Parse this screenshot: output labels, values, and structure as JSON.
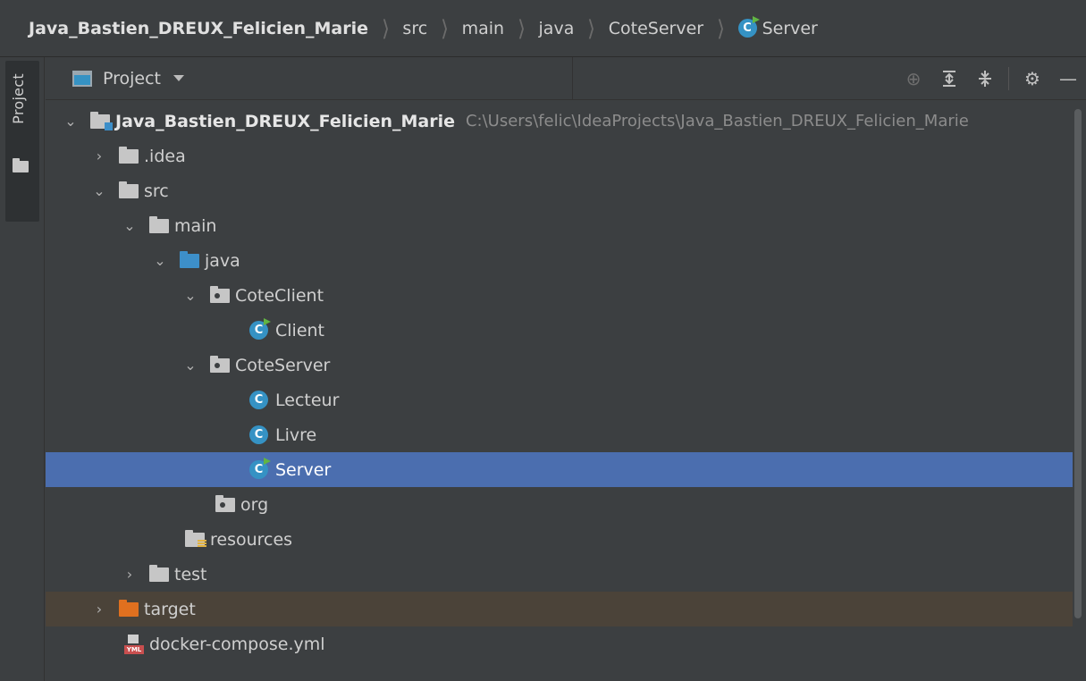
{
  "breadcrumb": {
    "items": [
      "Java_Bastien_DREUX_Felicien_Marie",
      "src",
      "main",
      "java",
      "CoteServer",
      "Server"
    ]
  },
  "tool_window": {
    "tab_label": "Project"
  },
  "project_panel": {
    "title": "Project"
  },
  "tree": {
    "root_name": "Java_Bastien_DREUX_Felicien_Marie",
    "root_path": "C:\\Users\\felic\\IdeaProjects\\Java_Bastien_DREUX_Felicien_Marie",
    "idea": ".idea",
    "src": "src",
    "main": "main",
    "java": "java",
    "cote_client": "CoteClient",
    "client": "Client",
    "cote_server": "CoteServer",
    "lecteur": "Lecteur",
    "livre": "Livre",
    "server": "Server",
    "org": "org",
    "resources": "resources",
    "test": "test",
    "target": "target",
    "docker_compose": "docker-compose.yml"
  },
  "colors": {
    "selection": "#4b6eaf",
    "excluded_row": "#4b4339",
    "class_icon": "#3592c4",
    "run_marker": "#62b543"
  }
}
